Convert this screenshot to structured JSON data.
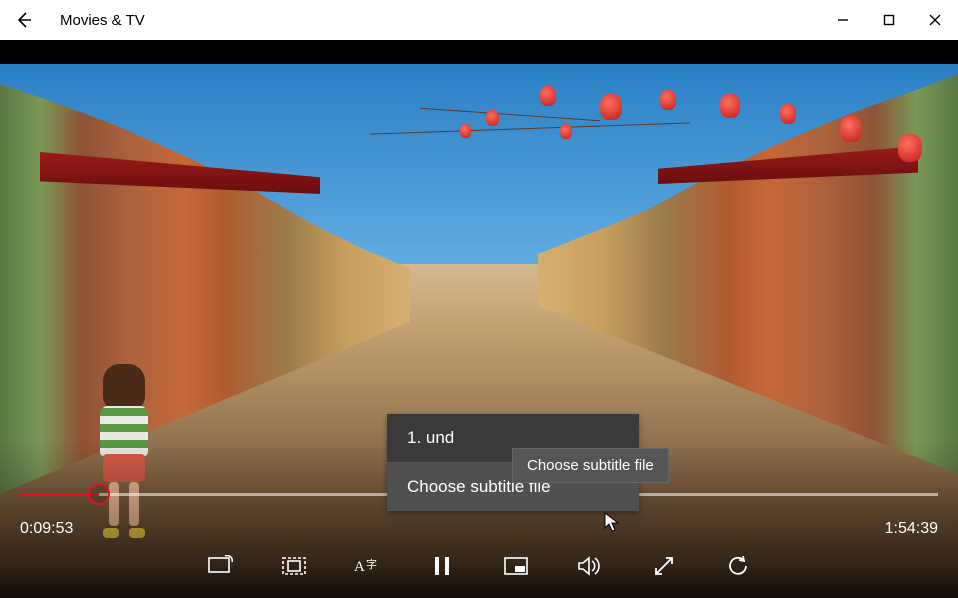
{
  "titlebar": {
    "title": "Movies & TV"
  },
  "window_controls": {
    "minimize": "—",
    "maximize": "☐",
    "close": "✕"
  },
  "playback": {
    "current_time": "0:09:53",
    "total_time": "1:54:39",
    "progress_percent": 8.6
  },
  "subtitle_menu": {
    "items": [
      {
        "label": "1. und"
      },
      {
        "label": "Choose subtitle file"
      }
    ],
    "tooltip": "Choose subtitle file"
  },
  "controls": {
    "cast": "cast",
    "aspect": "aspect",
    "subtitles_cc": "subtitles",
    "play_pause": "pause",
    "mini_view": "mini",
    "volume": "volume",
    "fullscreen": "fullscreen",
    "repeat": "repeat"
  }
}
